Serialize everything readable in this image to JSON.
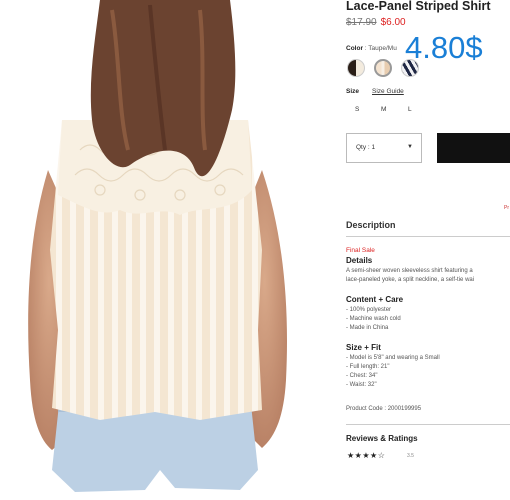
{
  "product": {
    "title": "Lace-Panel Striped Shirt",
    "old_price": "$17.90",
    "sale_price": "$6.00",
    "overlay_price": "4.80$"
  },
  "color": {
    "label": "Color",
    "selected": ": Taupe/Mu",
    "swatch_colors": [
      "#2a1e17",
      "#f4e3d0",
      "#1f2744"
    ]
  },
  "size": {
    "label": "Size",
    "guide": "Size Guide",
    "options": [
      "S",
      "M",
      "L"
    ]
  },
  "qty": {
    "text": "Qty : 1",
    "caret": "▼"
  },
  "promo_text": "Pr",
  "description": {
    "heading": "Description",
    "final_sale": "Final Sale",
    "details_heading": "Details",
    "details_line1": "A semi-sheer woven sleeveless shirt featuring a",
    "details_line2": "lace-paneled yoke, a split neckline, a self-tie wai",
    "content_heading": "Content + Care",
    "content_items": [
      "- 100% polyester",
      "- Machine wash cold",
      "- Made in China"
    ],
    "fit_heading": "Size + Fit",
    "fit_items": [
      "- Model is 5'8\" and wearing a Small",
      "- Full length: 21\"",
      "- Chest: 34\"",
      "- Waist: 32\""
    ],
    "product_code": "Product Code : 2000199995"
  },
  "reviews": {
    "heading": "Reviews & Ratings",
    "stars": "★★★★☆",
    "rating": "3.5"
  }
}
